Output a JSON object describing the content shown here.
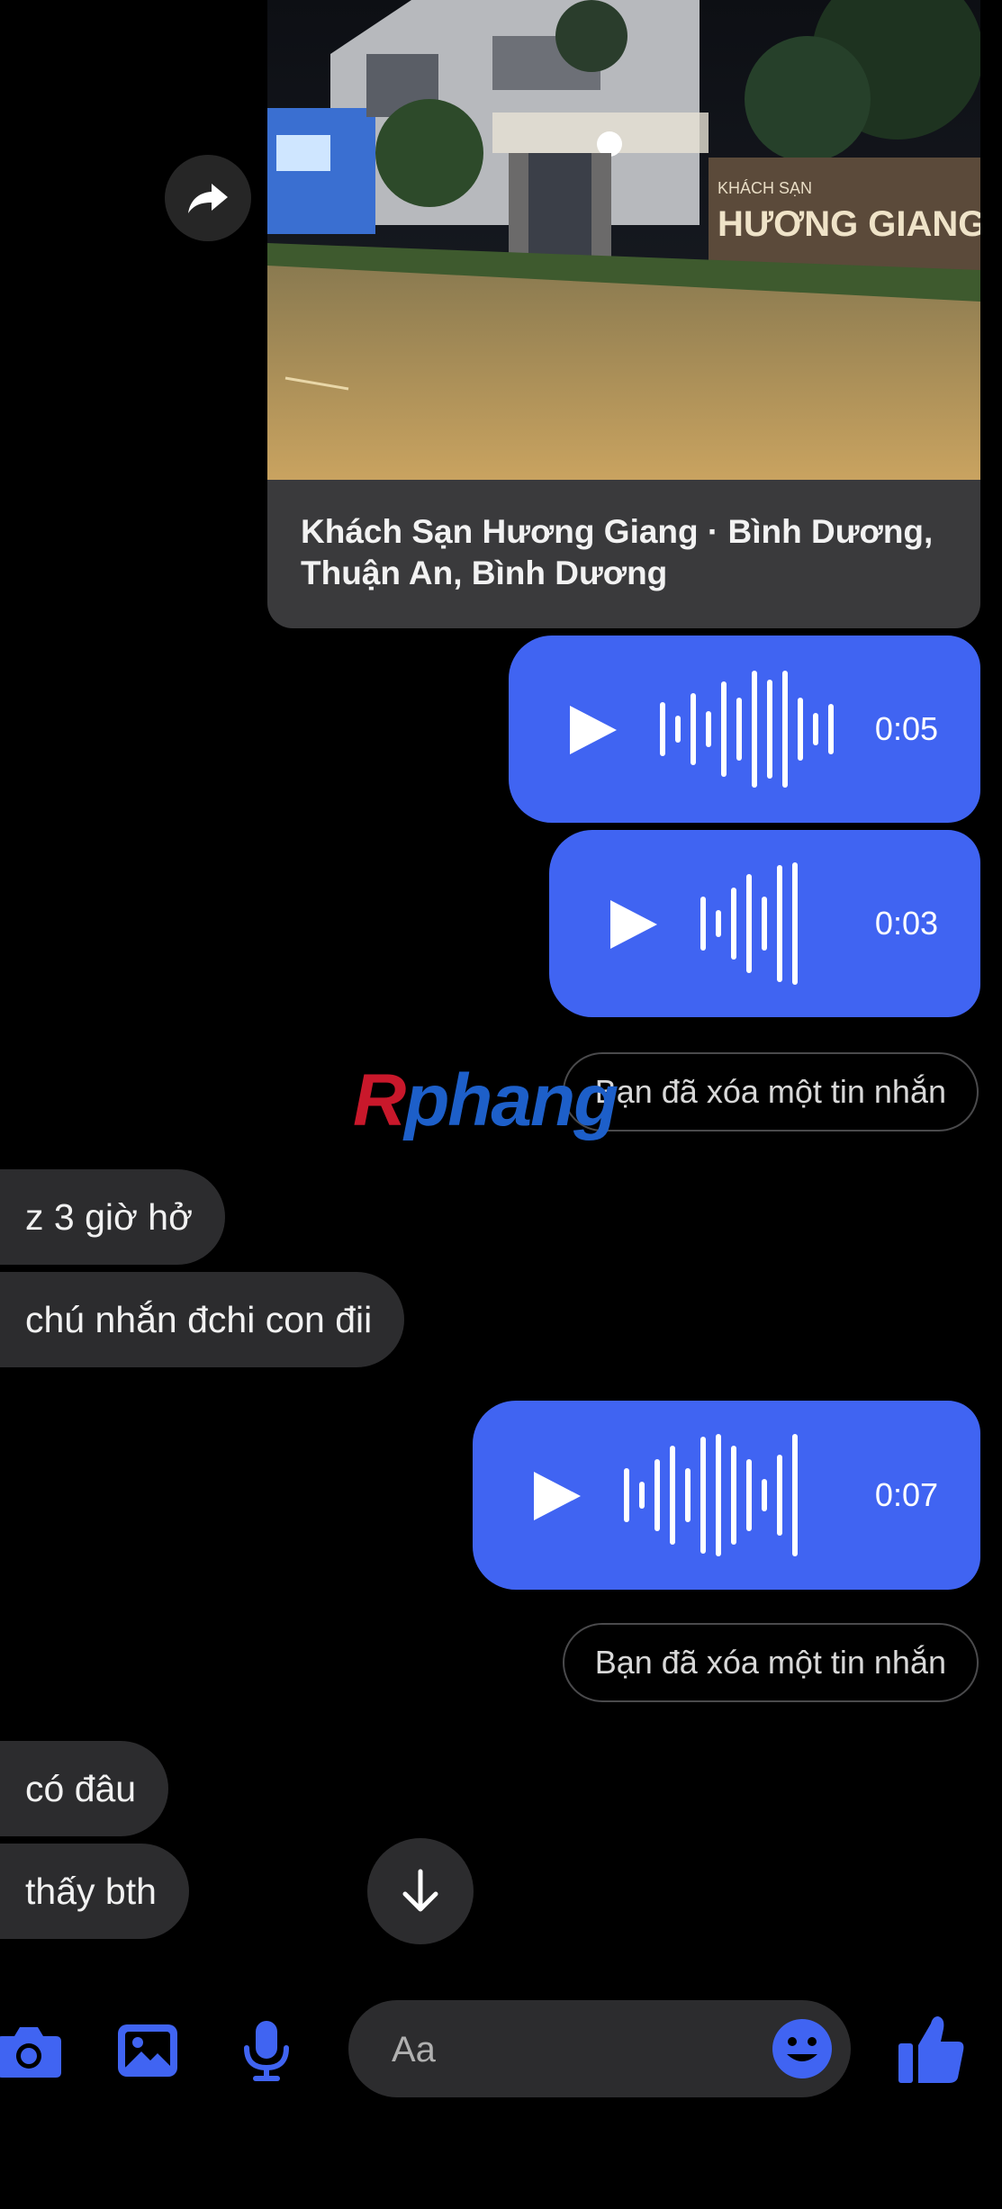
{
  "thread": {
    "shared_location": {
      "caption": "Khách Sạn Hương Giang · Bình Dương, Thuận An, Bình Dương",
      "sign_line_1": "KHÁCH SẠN",
      "sign_line_2": "HƯƠNG GIANG"
    },
    "voice_messages": [
      {
        "duration": "0:05"
      },
      {
        "duration": "0:03"
      },
      {
        "duration": "0:07"
      }
    ],
    "deleted_notice_1": "Bạn đã xóa một tin nhắn",
    "deleted_notice_2": "Bạn đã xóa một tin nhắn",
    "received": [
      "z 3 giờ hở",
      "chú nhắn đchi con đii",
      "có đâu",
      "thấy bth"
    ]
  },
  "watermark": {
    "first": "R",
    "rest": "phang"
  },
  "composer": {
    "placeholder": "Aa"
  },
  "colors": {
    "accent": "#4064f2",
    "bubble_received": "#2c2c2e",
    "background": "#000000"
  },
  "icons": [
    "share-icon",
    "play-icon",
    "arrow-down-icon",
    "camera-icon",
    "image-icon",
    "microphone-icon",
    "emoji-icon",
    "thumbs-up-icon"
  ]
}
